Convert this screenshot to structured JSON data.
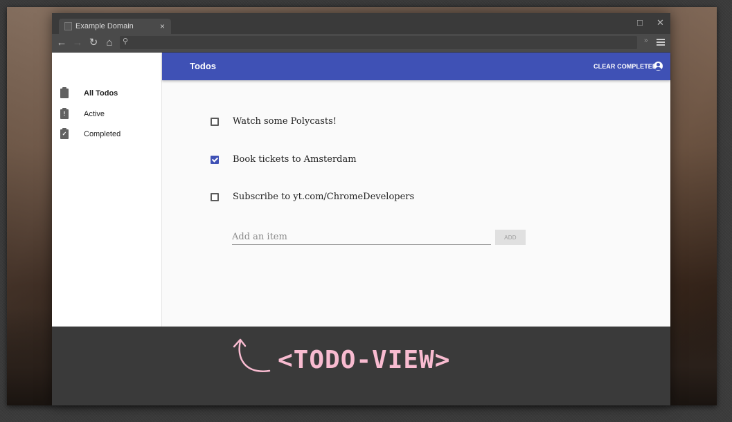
{
  "browser": {
    "tab_title": "Example Domain",
    "tab_close": "×",
    "window_controls": {
      "maximize": "□",
      "close": "✕"
    },
    "nav": {
      "back": "←",
      "forward": "→",
      "reload": "↻",
      "home": "⌂"
    },
    "omnibox_value": "",
    "omnibox_icon": "search-icon",
    "star_icon": "»",
    "menu_icon": "hamburger-menu-icon"
  },
  "sidebar": {
    "items": [
      {
        "label": "All Todos",
        "icon": "clipboard-icon",
        "glyph": "",
        "selected": true
      },
      {
        "label": "Active",
        "icon": "clipboard-alert-icon",
        "glyph": "!",
        "selected": false
      },
      {
        "label": "Completed",
        "icon": "clipboard-check-icon",
        "glyph": "✓",
        "selected": false
      }
    ]
  },
  "appbar": {
    "title": "Todos",
    "clear_label": "CLEAR COMPLETED",
    "account_icon": "account-circle-icon",
    "color": "#3f51b5"
  },
  "todos": [
    {
      "text": "Watch some Polycasts!",
      "done": false
    },
    {
      "text": "Book tickets to Amsterdam",
      "done": true
    },
    {
      "text": "Subscribe to yt.com/ChromeDevelopers",
      "done": false
    }
  ],
  "add": {
    "placeholder": "Add an item",
    "value": "",
    "button_label": "ADD"
  },
  "annotation": {
    "label": "<TODO-VIEW>",
    "color": "#f8bbd0",
    "arrow_icon": "curved-arrow-icon"
  }
}
